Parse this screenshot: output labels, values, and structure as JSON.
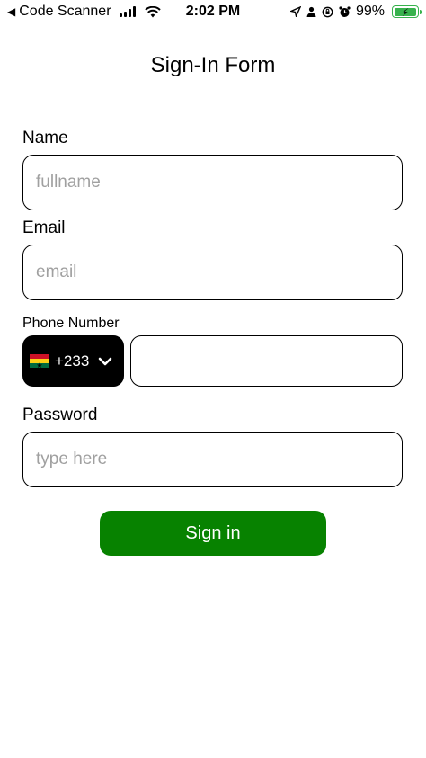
{
  "status_bar": {
    "back_glyph": "◀",
    "app_name": "Code Scanner",
    "time": "2:02 PM",
    "battery_percent": "99%"
  },
  "title": "Sign-In Form",
  "form": {
    "name": {
      "label": "Name",
      "placeholder": "fullname",
      "value": ""
    },
    "email": {
      "label": "Email",
      "placeholder": "email",
      "value": ""
    },
    "phone": {
      "label": "Phone Number",
      "country_code": "+233",
      "country": "Ghana",
      "value": ""
    },
    "password": {
      "label": "Password",
      "placeholder": "type here",
      "value": ""
    },
    "submit_label": "Sign in"
  },
  "colors": {
    "submit_bg": "#078200",
    "country_picker_bg": "#000000",
    "battery": "#37b24d"
  },
  "icons": [
    "back-icon",
    "signal-icon",
    "wifi-icon",
    "location-icon",
    "person-icon",
    "lock-rotation-icon",
    "alarm-icon",
    "battery-icon",
    "ghana-flag-icon",
    "chevron-down-icon"
  ]
}
